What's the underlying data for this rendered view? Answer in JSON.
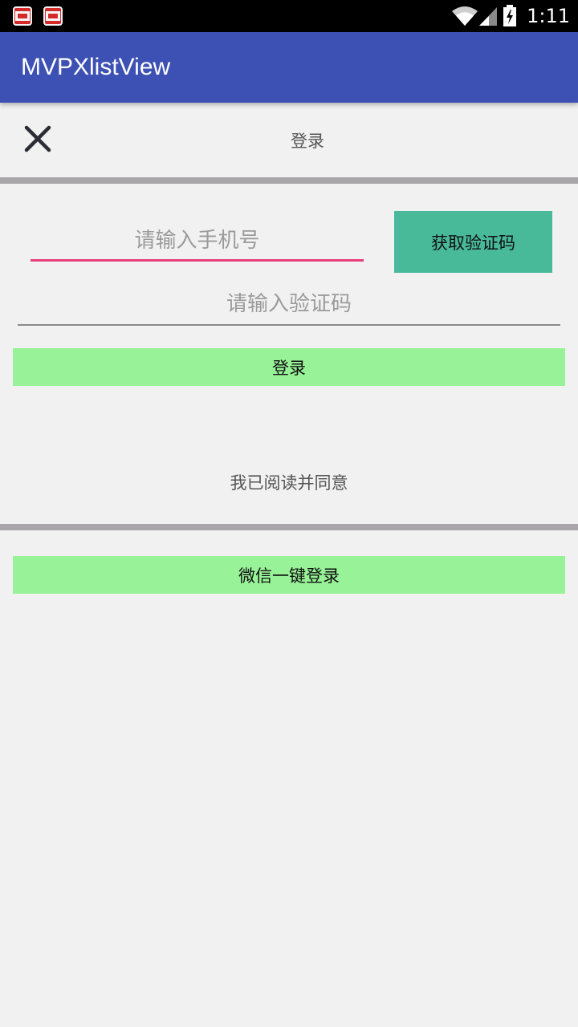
{
  "status_bar": {
    "time": "1:11",
    "notification_icons": [
      "toutiao-app-icon",
      "toutiao-app-icon"
    ],
    "icons": [
      "wifi-icon",
      "signal-icon",
      "battery-charging-icon"
    ]
  },
  "app_bar": {
    "title": "MVPXlistView"
  },
  "header": {
    "title": "登录",
    "close_icon": "close-icon"
  },
  "form": {
    "phone_placeholder": "请输入手机号",
    "phone_value": "",
    "get_code_label": "获取验证码",
    "code_placeholder": "请输入验证码",
    "code_value": "",
    "login_label": "登录",
    "agree_text": "我已阅读并同意"
  },
  "wechat": {
    "login_label": "微信一键登录"
  },
  "colors": {
    "app_bar": "#3d51b4",
    "accent_underline": "#e63f7a",
    "get_code_button": "#48b999",
    "green_button": "#98f298",
    "divider": "#a8a6a8",
    "background": "#f1f1f1"
  }
}
